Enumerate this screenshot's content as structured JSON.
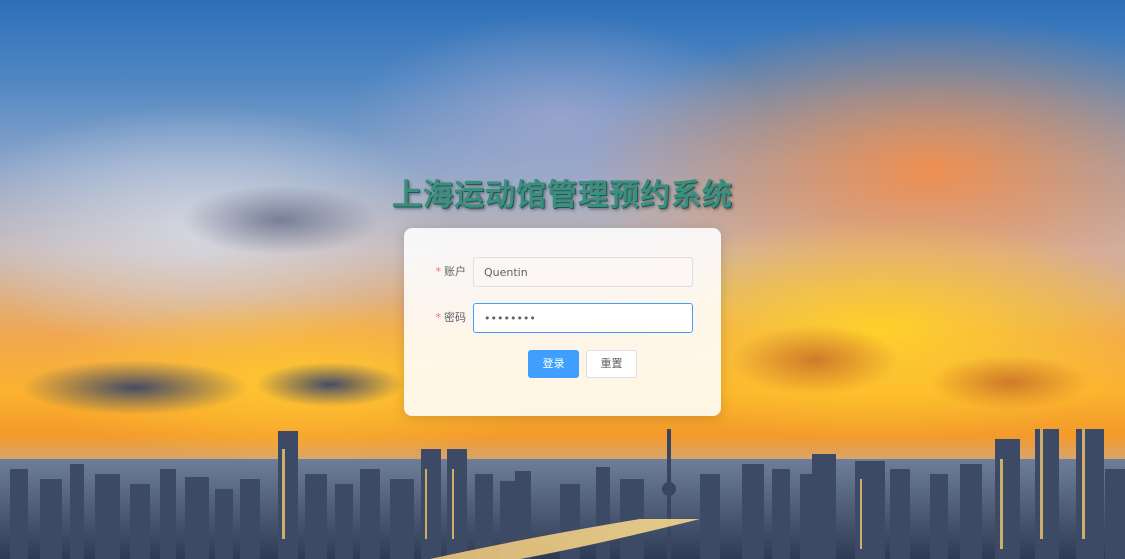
{
  "page": {
    "title": "上海运动馆管理预约系统"
  },
  "login_form": {
    "account_label": "账户",
    "account_value": "Quentin",
    "password_label": "密码",
    "password_value": "••••••••",
    "required_mark": "*",
    "submit_label": "登录",
    "reset_label": "重置"
  },
  "colors": {
    "title_green": "#3b8f7f",
    "primary_button": "#409eff",
    "required_star": "#f56c6c"
  }
}
